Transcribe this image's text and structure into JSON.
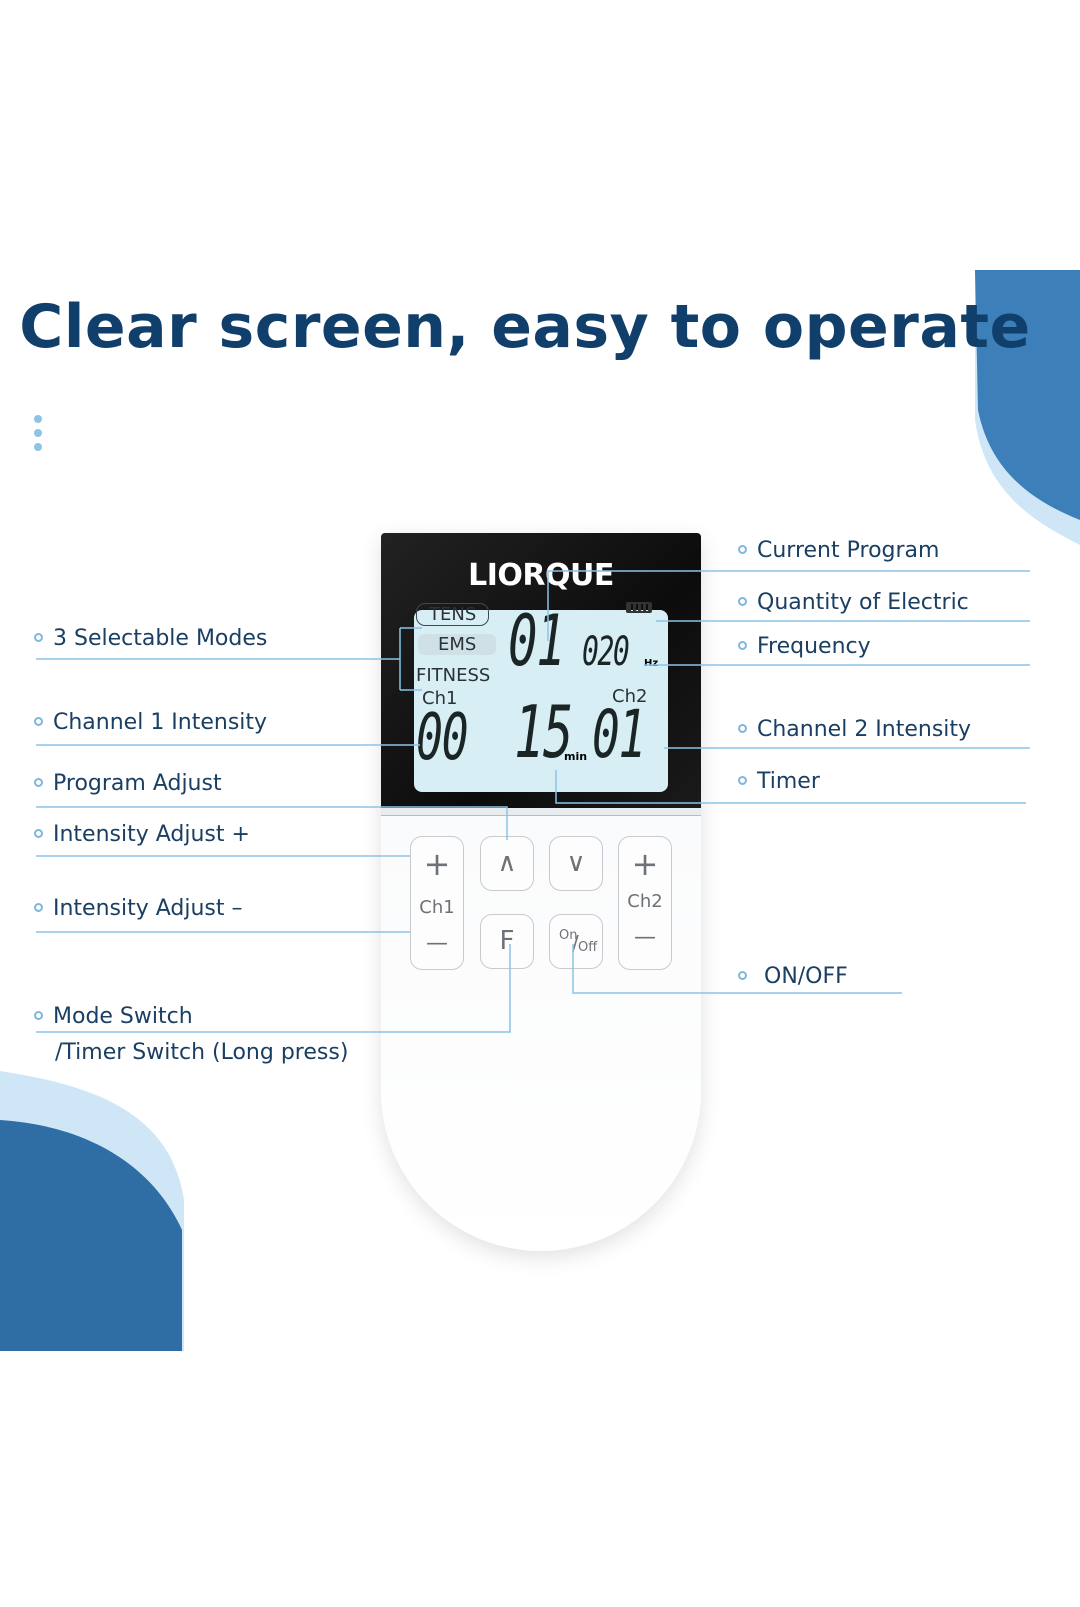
{
  "title": "Clear screen, easy to operate",
  "colors": {
    "title": "#113f6b",
    "accent": "#2e6fa7",
    "light_accent": "#c9e4f6",
    "leader_line": "#8cc3e6"
  },
  "device": {
    "brand": "LIORQUE",
    "lcd": {
      "modes": [
        "TENS",
        "EMS",
        "FITNESS"
      ],
      "selected_mode": "TENS",
      "program": "01",
      "frequency": "020",
      "frequency_unit": "Hz",
      "ch1_label": "Ch1",
      "ch1_value": "00",
      "ch2_label": "Ch2",
      "ch2_value": "01",
      "timer": "15",
      "timer_unit": "min",
      "battery_icon": "battery-icon"
    },
    "buttons": {
      "ch1_label": "Ch1",
      "ch2_label": "Ch2",
      "plus": "+",
      "minus": "—",
      "up": "∧",
      "down": "∨",
      "f": "F",
      "on": "On",
      "off": "Off"
    }
  },
  "left_labels": [
    "3 Selectable Modes",
    "Channel 1 Intensity",
    "Program Adjust",
    "Intensity Adjust +",
    "Intensity Adjust –",
    "Mode Switch",
    "/Timer Switch (Long press)"
  ],
  "right_labels": [
    "Current Program",
    "Quantity of Electric",
    "Frequency",
    "Channel 2 Intensity",
    "Timer",
    "ON/OFF"
  ]
}
